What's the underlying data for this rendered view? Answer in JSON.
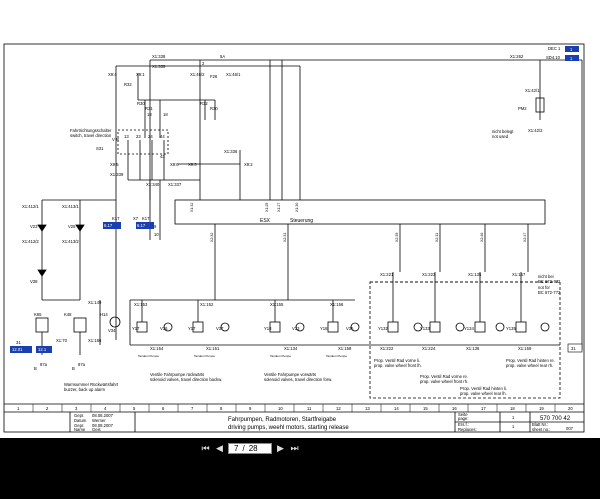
{
  "top_tags": {
    "dec": "DEC 1",
    "dec_ref": "1",
    "sd": "SD4.10",
    "sd_ref": "1"
  },
  "sheet_ids": {
    "cs1": "31",
    "cs2": "31"
  },
  "connector_top": {
    "x1_338": "X1:338",
    "x1_335": "X1:335",
    "x9_4": "X9:4",
    "x9_1": "X9:1",
    "f26_num": "2",
    "f26": "F26",
    "f26_rating": "5A",
    "x1_46_2": "X1:46/2",
    "x1_46_1": "X1:46/1",
    "x1_262": "X1:262",
    "x1_42_1": "X1:42/1",
    "pm2": "PM2",
    "x1_42_2": "X1:42/2",
    "not_used_de": "nicht belegt",
    "not_used_en": "not used"
  },
  "direction_switch": {
    "r32": "R32",
    "r30": "R30",
    "r31": "R31",
    "r32b": "R32",
    "r30b": "R30",
    "k_r30": "18",
    "k_r31": "18",
    "label_de": "Fahrtrichtungsschalter",
    "label_en": "switch, travel direction",
    "s31": "S31",
    "v_r": "V R",
    "c13": "13",
    "c23": "23",
    "c24": "24",
    "c44": "44",
    "c43": "43",
    "x9_5": "X9:5",
    "x9_3": "X9:3",
    "x9_6": "X9:6",
    "x9_2": "X9:2",
    "x1_339": "X1:339",
    "x1_336": "X1:336",
    "x1_340": "X1:340",
    "x1_337": "X1:337",
    "c9": "9",
    "c10": "10"
  },
  "esx": {
    "label": "ESX",
    "control": "Steuerung",
    "pins_top": [
      "X1:32",
      "X1:25",
      "X1:27",
      "X1:30"
    ],
    "pins_bot": [
      "X2:32",
      "X2:31",
      "X2:39",
      "X2:11",
      "X2:46",
      "X2:47",
      "X2:49",
      "X2:50"
    ],
    "sig_left": "Ausgang Ventil",
    "sig_right": "Ausgang Ventil"
  },
  "left_branch": {
    "x1_412_1": "X1:412/1",
    "x1_413_1": "X1:413/1",
    "v23": "V23",
    "v25": "V25",
    "x1_412_2": "X1:412/2",
    "x1_413_2": "X1:413/2",
    "v38": "V38",
    "k17": "K17",
    "x7": "X7",
    "k17b": "K17",
    "k17_ref": "6.17",
    "k17b_ref": "6.17",
    "k65": "K65",
    "k48": "K48",
    "h14": "H14",
    "v34": "V34",
    "x1_149": "X1:149",
    "x1_70": "X1:70",
    "x1_186": "X1:186",
    "ref_left": "12.01",
    "ref_mid": "12.1",
    "gnd1": "87a",
    "gnd2": "87a",
    "gnd1b": "B",
    "gnd2b": "B",
    "alarm_de": "Warnsummer Rückwärtsfahrt",
    "alarm_en": "buzzer, back up alarm"
  },
  "valves": {
    "x1_153": "X1:153",
    "x1_152": "X1:152",
    "x1_155": "X1:155",
    "x1_156": "X1:156",
    "y17": "Y17",
    "v36": "V36",
    "y17b": "Y17",
    "v37": "V37",
    "y18": "Y18",
    "v33": "V33",
    "y18b": "Y18",
    "v35": "V35",
    "x1_154": "X1:154",
    "x1_151": "X1:151",
    "x1_134": "X1:134",
    "x1_158": "X1:158",
    "tp1": "Tandem Pumpe",
    "tp2": "Tandem Pumpe",
    "tp3": "Tandem Pumpe",
    "tp4": "Tandem Pumpe",
    "rev_de": "Ventile Fahrpumpe rückwärts",
    "rev_en": "solenoid valves, travel direction backw.",
    "fwd_de": "Ventile Fahrpumpe vorwärts",
    "fwd_en": "solenoid valves, travel direction forw.",
    "sub1": "Fahrpumpe Rückwärts",
    "sub2": "Fahrpumpe Rückwärts",
    "sub3": "Fahrpumpe Vorwärts",
    "sub4": "Fahrpumpe Vorwärts"
  },
  "right_valves": {
    "x1_221": "X1:221",
    "x1_223": "X1:223",
    "x1_135": "X1:135",
    "x1_157": "X1:157",
    "y132": "Y132",
    "y133": "Y133",
    "y134": "Y134",
    "y135": "Y135",
    "x1_222": "X1:222",
    "x1_224": "X1:224",
    "x1_136": "X1:136",
    "x1_159": "X1:159",
    "bc_note1": "nicht bei",
    "bc_note2": "BC 672-772",
    "bc_note3": "not for",
    "bc_note4": "BC 672-772",
    "fl_de": "Prop. Ventil Rad vorne li.",
    "fl_en": "prop. valve wheel front lh.",
    "rr_de": "Prop. Ventil Rad hinten re.",
    "rr_en": "prop. valve wheel rear rh.",
    "fr_de": "Prop. Ventil Rad vorne re.",
    "fr_en": "prop. valve wheel front rh.",
    "rl_de": "Prop. Ventil Rad hinten li.",
    "rl_en": "prop. valve wheel rear lh."
  },
  "grid_numbers": [
    "1",
    "2",
    "3",
    "4",
    "5",
    "6",
    "7",
    "8",
    "9",
    "10",
    "11",
    "12",
    "13",
    "14",
    "15",
    "16",
    "17",
    "18",
    "19",
    "20"
  ],
  "title_block": {
    "drawn_label": "Gepr.",
    "drawn_date": "08.08.2007",
    "drawn_name": "Werner",
    "date_label": "Datum",
    "checked_label": "Gepr.",
    "checked_date": "08.08.2007",
    "name_label": "Name",
    "checked_name": "Geis",
    "title_de": "Fahrpumpen, Radmotoren, Startfreigabe",
    "title_en": "driving pumps, weehl motors, starting release",
    "seite_label": "Seite",
    "page_label": "page:",
    "seite_value": "1",
    "ers_label": "Ers.f.:",
    "replaces_label": "Replaces:",
    "blatt_label": "Blatt Nr.:",
    "sheet_label": "sheet no.:",
    "sheet_value": "1",
    "doc_no": "570 700 42",
    "rev": "007"
  },
  "viewer": {
    "prev_first": "⏮",
    "prev": "◀",
    "current": "7",
    "sep": "/",
    "total": "28",
    "next": "▶",
    "next_last": "⏭"
  }
}
